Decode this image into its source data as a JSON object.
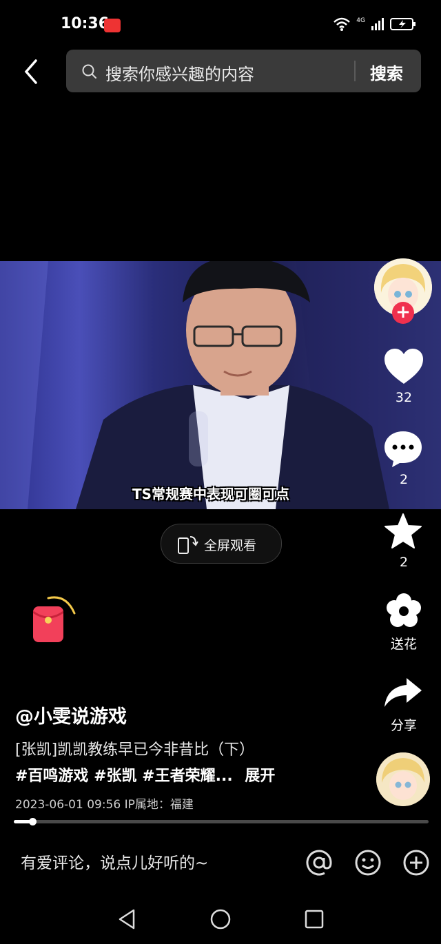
{
  "status_bar": {
    "time": "10:36",
    "network": "4G"
  },
  "search": {
    "placeholder": "搜索你感兴趣的内容",
    "button_label": "搜索"
  },
  "video": {
    "subtitle": "TS常规赛中表现可圈可点",
    "fullscreen_label": "全屏观看"
  },
  "actions": {
    "like_count": "32",
    "comment_count": "2",
    "favorite_count": "2",
    "flower_label": "送花",
    "share_label": "分享"
  },
  "post": {
    "author": "@小雯说游戏",
    "description": "[张凯]凯凯教练早已今非昔比（下）",
    "tags": "#百鸣游戏 #张凯 #王者荣耀...",
    "expand_label": "展开",
    "meta": "2023-06-01 09:56  IP属地：福建",
    "progress": 0.045
  },
  "comment_bar": {
    "placeholder": "有爱评论，说点儿好听的~"
  },
  "colors": {
    "accent_red": "#f0304e",
    "background": "#000000"
  }
}
